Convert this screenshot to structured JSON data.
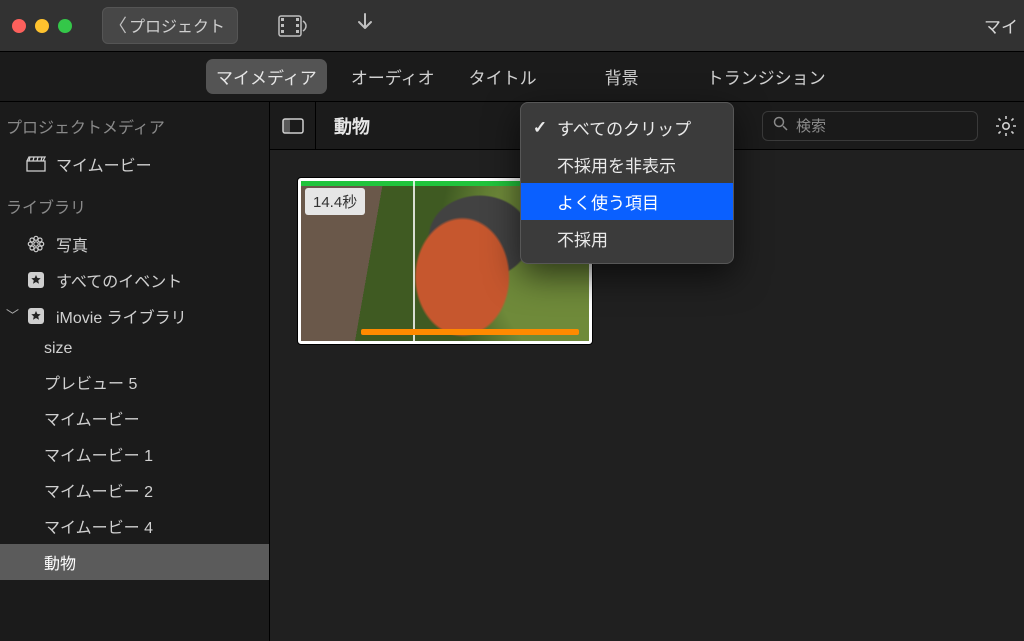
{
  "titlebar": {
    "projects_button": "プロジェクト",
    "right_truncated": "マイ"
  },
  "tabs": {
    "my_media": "マイメディア",
    "audio": "オーディオ",
    "titles": "タイトル",
    "backgrounds": "背景",
    "transitions": "トランジション"
  },
  "sidebar": {
    "section_project_media": "プロジェクトメディア",
    "my_movie": "マイムービー",
    "section_libraries": "ライブラリ",
    "photos": "写真",
    "all_events": "すべてのイベント",
    "imovie_library": "iMovie ライブラリ",
    "items": {
      "size": "size",
      "preview5": "プレビュー 5",
      "mm": "マイムービー",
      "mm1": "マイムービー 1",
      "mm2": "マイムービー 2",
      "mm4": "マイムービー 4",
      "animals": "動物"
    }
  },
  "browser": {
    "title": "動物",
    "search_placeholder": "検索",
    "clip_duration": "14.4秒"
  },
  "dropdown": {
    "all_clips": "すべてのクリップ",
    "hide_rejected": "不採用を非表示",
    "favorites": "よく使う項目",
    "rejected": "不採用"
  }
}
